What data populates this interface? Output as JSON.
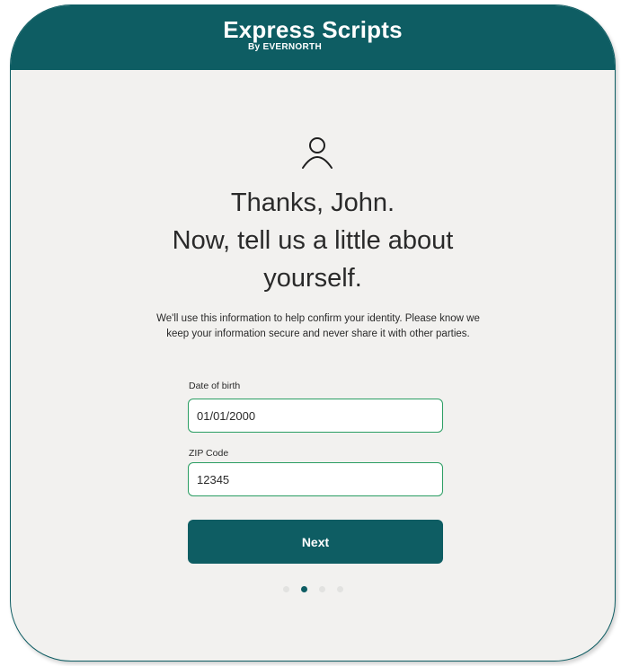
{
  "header": {
    "brand_title": "Express Scripts",
    "brand_sub": "By EVERNORTH"
  },
  "icons": {
    "user": "user-icon"
  },
  "main": {
    "heading_line1": "Thanks, John.",
    "heading_line2": "Now, tell us a little about",
    "heading_line3": "yourself.",
    "info_text": "We'll use this information to help confirm your identity. Please know we keep your information secure and never share it with other parties."
  },
  "form": {
    "dob_label": "Date of birth",
    "dob_value": "01/01/2000",
    "zip_label": "ZIP Code",
    "zip_value": "12345",
    "next_label": "Next"
  },
  "progress": {
    "total_steps": 4,
    "current_step": 2
  },
  "colors": {
    "brand": "#0e5d63",
    "input_border": "#2a9d62",
    "background": "#f2f1ef"
  }
}
